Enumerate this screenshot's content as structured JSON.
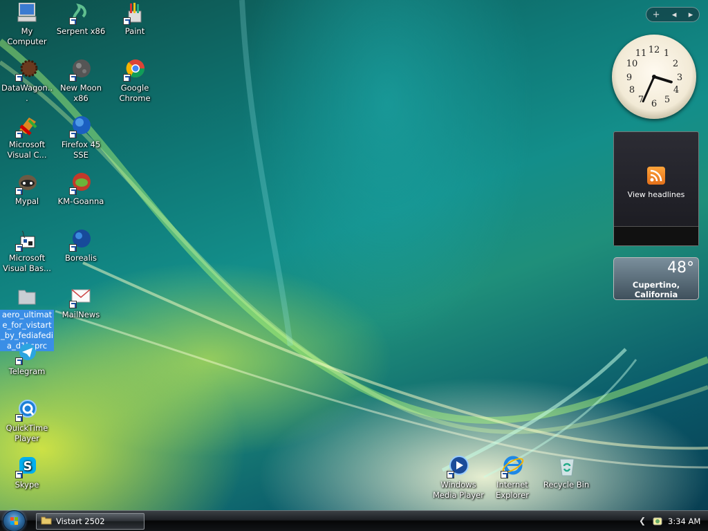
{
  "desktop": {
    "icons": [
      {
        "id": "my-computer",
        "label": "My Computer",
        "shortcut": false
      },
      {
        "id": "serpent",
        "label": "Serpent x86",
        "shortcut": true
      },
      {
        "id": "paint",
        "label": "Paint",
        "shortcut": true
      },
      {
        "id": "datawagon",
        "label": "DataWagon...",
        "shortcut": true
      },
      {
        "id": "new-moon",
        "label": "New Moon x86",
        "shortcut": true
      },
      {
        "id": "chrome",
        "label": "Google Chrome",
        "shortcut": true
      },
      {
        "id": "ms-visual-c",
        "label": "Microsoft Visual C...",
        "shortcut": true
      },
      {
        "id": "firefox",
        "label": "Firefox 45 SSE",
        "shortcut": true
      },
      {
        "id": "mypal",
        "label": "Mypal",
        "shortcut": true
      },
      {
        "id": "km-goanna",
        "label": "KM-Goanna",
        "shortcut": true
      },
      {
        "id": "ms-visual-basic",
        "label": "Microsoft Visual Bas...",
        "shortcut": true
      },
      {
        "id": "borealis",
        "label": "Borealis",
        "shortcut": true
      },
      {
        "id": "aero-folder",
        "label": "aero_ultimate_for_vistart_by_fediafedia_d1ksprc",
        "shortcut": false,
        "selected": true
      },
      {
        "id": "mailnews",
        "label": "MailNews",
        "shortcut": true
      },
      {
        "id": "telegram",
        "label": "Telegram",
        "shortcut": true
      },
      {
        "id": "quicktime",
        "label": "QuickTime Player",
        "shortcut": true
      },
      {
        "id": "skype",
        "label": "Skype",
        "shortcut": true
      },
      {
        "id": "wmp",
        "label": "Windows Media Player",
        "shortcut": true
      },
      {
        "id": "ie",
        "label": "Internet Explorer",
        "shortcut": true
      },
      {
        "id": "recycle-bin",
        "label": "Recycle Bin",
        "shortcut": false
      }
    ]
  },
  "gadgets": {
    "controls": {
      "add": "+",
      "prev": "◂",
      "next": "▸"
    },
    "clock": {
      "hour": 3,
      "minute": 34
    },
    "feed": {
      "label": "View headlines"
    },
    "weather": {
      "temperature": "48°",
      "city": "Cupertino, California"
    }
  },
  "taskbar": {
    "task_label": "Vistart 2502",
    "tray_chevron": "❮",
    "time": "3:34 AM"
  }
}
